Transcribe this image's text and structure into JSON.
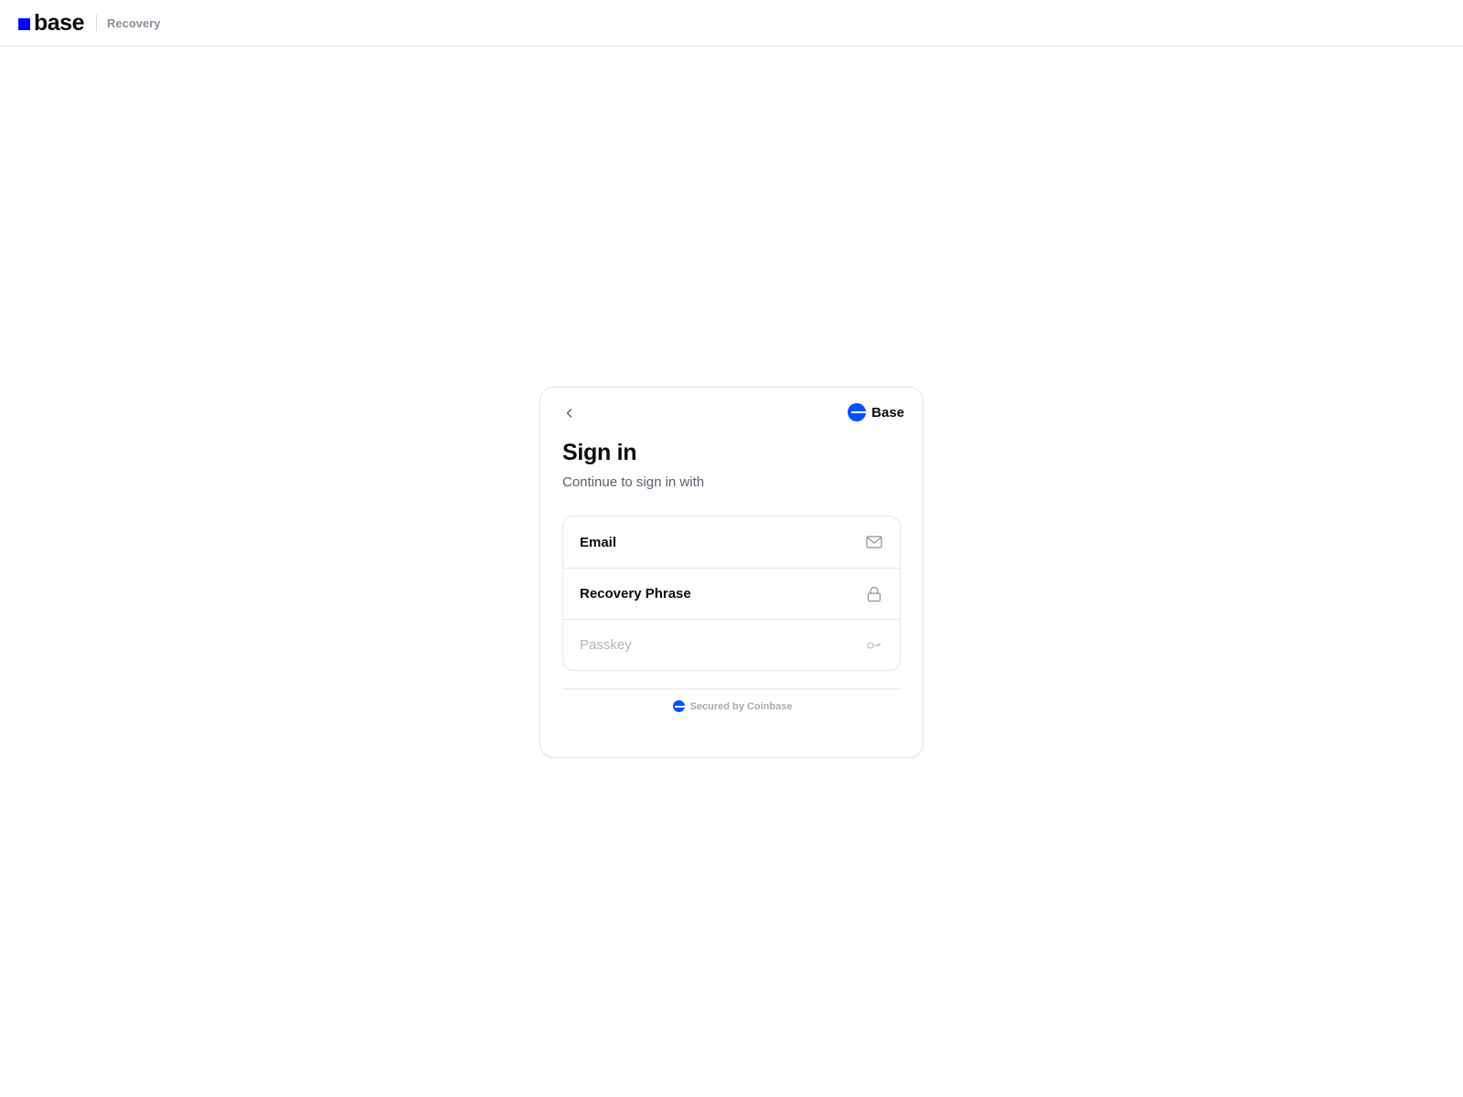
{
  "header": {
    "logo_text": "base",
    "section": "Recovery"
  },
  "card": {
    "brand_name": "Base",
    "title": "Sign in",
    "subtitle": "Continue to sign in with",
    "options": [
      {
        "label": "Email",
        "icon": "mail-icon",
        "enabled": true
      },
      {
        "label": "Recovery Phrase",
        "icon": "lock-icon",
        "enabled": true
      },
      {
        "label": "Passkey",
        "icon": "key-icon",
        "enabled": false
      }
    ],
    "footer": "Secured by Coinbase"
  },
  "colors": {
    "logo_square": "#0000ff",
    "brand_blue": "#0052ff",
    "disabled_text": "#b1b5bd"
  }
}
